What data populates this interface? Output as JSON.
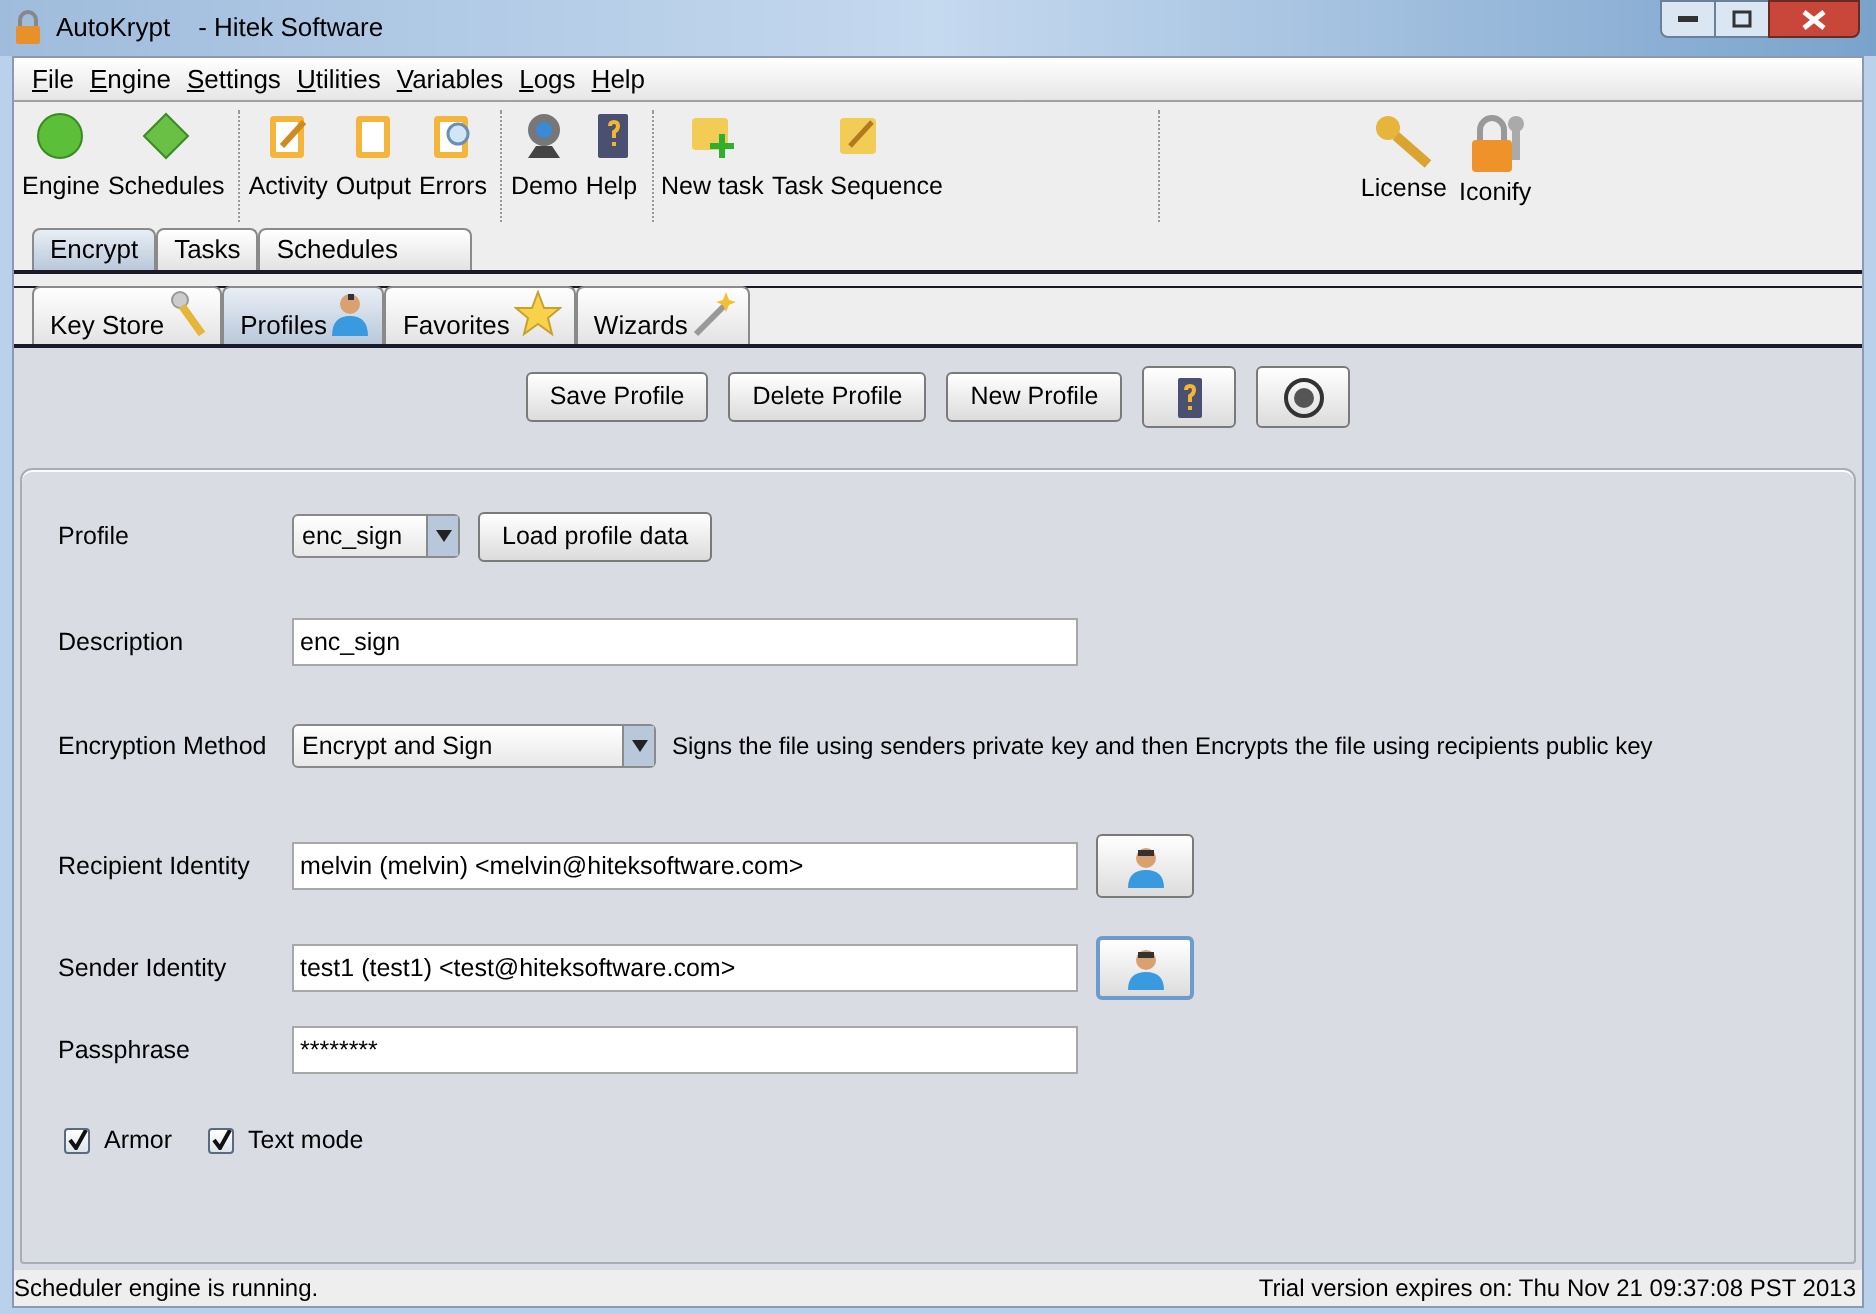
{
  "window": {
    "title": "AutoKrypt",
    "subtitle": "- Hitek Software"
  },
  "menu": [
    "File",
    "Engine",
    "Settings",
    "Utilities",
    "Variables",
    "Logs",
    "Help"
  ],
  "toolbar": [
    {
      "items": [
        "Engine",
        "Schedules"
      ]
    },
    {
      "items": [
        "Activity",
        "Output",
        "Errors"
      ]
    },
    {
      "items": [
        "Demo",
        "Help"
      ]
    },
    {
      "items": [
        "New task",
        "Task Sequence"
      ]
    }
  ],
  "toolbar_right": [
    "License",
    "Iconify"
  ],
  "tabs": [
    {
      "label": "Encrypt",
      "selected": true
    },
    {
      "label": "Tasks",
      "selected": false
    },
    {
      "label": "Schedules",
      "selected": false
    }
  ],
  "subtabs": [
    {
      "label": "Key Store",
      "selected": false
    },
    {
      "label": "Profiles",
      "selected": true
    },
    {
      "label": "Favorites",
      "selected": false
    },
    {
      "label": "Wizards",
      "selected": false
    }
  ],
  "actions": [
    "Save Profile",
    "Delete Profile",
    "New Profile"
  ],
  "form": {
    "profile": {
      "label": "Profile",
      "value": "enc_sign",
      "button": "Load profile data"
    },
    "description": {
      "label": "Description",
      "value": "enc_sign"
    },
    "encryption": {
      "label": "Encryption Method",
      "value": "Encrypt and Sign",
      "hint": "Signs the file using senders private key and then Encrypts the file using recipients public key"
    },
    "identities": [
      {
        "label": "Recipient Identity",
        "value": "melvin (melvin) <melvin@hiteksoftware.com>",
        "focused": false
      },
      {
        "label": "Sender Identity",
        "value": "test1 (test1) <test@hiteksoftware.com>",
        "focused": true
      }
    ],
    "passphrase": {
      "label": "Passphrase",
      "value": "********"
    },
    "options": [
      {
        "label": "Armor",
        "checked": true
      },
      {
        "label": "Text mode",
        "checked": true
      }
    ]
  },
  "status_bar": {
    "left": "Scheduler engine is running.",
    "right": "Trial version expires on: Thu Nov 21 09:37:08 PST 2013"
  }
}
